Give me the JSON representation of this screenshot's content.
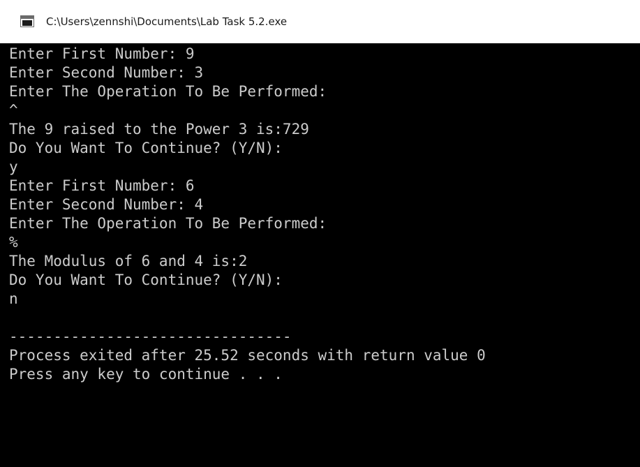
{
  "window": {
    "title": "C:\\Users\\zennshi\\Documents\\Lab Task 5.2.exe",
    "icon": "console-app-icon"
  },
  "console": {
    "text_color": "#cccccc",
    "background": "#000000",
    "lines": [
      "Enter First Number: 9",
      "Enter Second Number: 3",
      "Enter The Operation To Be Performed:",
      "^",
      "The 9 raised to the Power 3 is:729",
      "Do You Want To Continue? (Y/N):",
      "y",
      "Enter First Number: 6",
      "Enter Second Number: 4",
      "Enter The Operation To Be Performed:",
      "%",
      "The Modulus of 6 and 4 is:2",
      "Do You Want To Continue? (Y/N):",
      "n",
      "",
      "--------------------------------",
      "Process exited after 25.52 seconds with return value 0",
      "Press any key to continue . . ."
    ]
  }
}
